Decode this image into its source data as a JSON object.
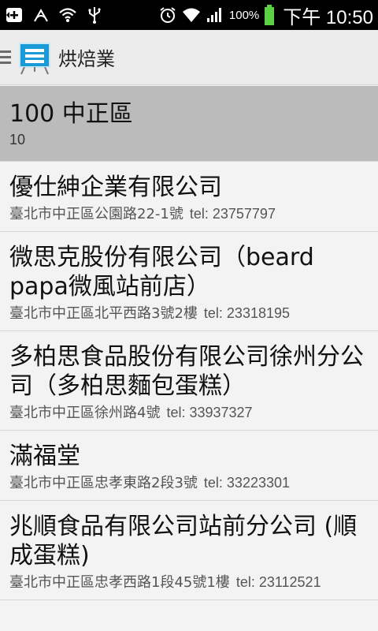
{
  "status_bar": {
    "battery_percent": "100%",
    "time": "下午 10:50",
    "icons": [
      "add-box-icon",
      "signal-arc-icon",
      "wifi-tether-icon",
      "usb-icon",
      "alarm-icon",
      "wifi-icon",
      "cell-signal-icon",
      "battery-icon"
    ],
    "battery_color": "#5bd243"
  },
  "action_bar": {
    "title": "烘焙業",
    "icon": "presentation-board-icon",
    "accent": "#1a9bd7"
  },
  "section_header": {
    "title": "100 中正區",
    "count": "10"
  },
  "items": [
    {
      "name": "優仕紳企業有限公司",
      "address": "臺北市中正區公園路22-1號",
      "tel": "tel: 23757797"
    },
    {
      "name": "微思克股份有限公司（beard papa微風站前店）",
      "address": "臺北市中正區北平西路3號2樓",
      "tel": "tel: 23318195"
    },
    {
      "name": "多柏思食品股份有限公司徐州分公司（多柏思麵包蛋糕）",
      "address": "臺北市中正區徐州路4號",
      "tel": "tel: 33937327"
    },
    {
      "name": "滿福堂",
      "address": "臺北市中正區忠孝東路2段3號",
      "tel": "tel: 33223301"
    },
    {
      "name": "兆順食品有限公司站前分公司 (順成蛋糕)",
      "address": "臺北市中正區忠孝西路1段45號1樓",
      "tel": "tel: 23112521"
    }
  ]
}
